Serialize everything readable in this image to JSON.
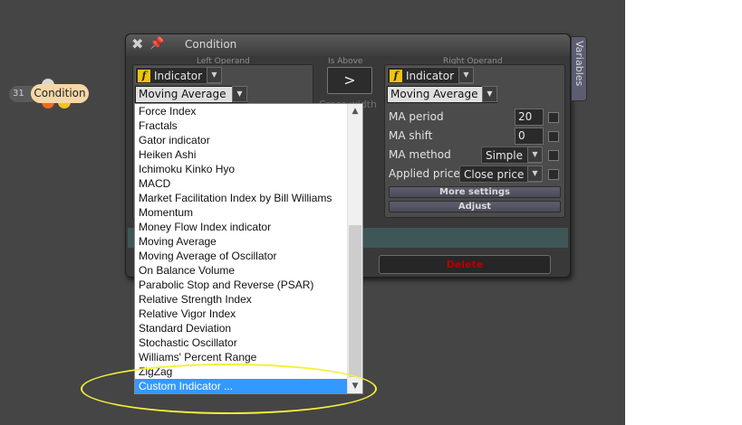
{
  "node": {
    "number": "31",
    "label": "Condition"
  },
  "dialog": {
    "title": "Condition",
    "variables_tab": "Variables",
    "left_operand_header": "Left Operand",
    "operator_header": "Is Above",
    "right_operand_header": "Right Operand",
    "operator_symbol": ">",
    "ghost_text": "Cross width",
    "delete_label": "Delete"
  },
  "left": {
    "type_label": "Indicator",
    "indicator_selected": "Moving Average"
  },
  "right": {
    "type_label": "Indicator",
    "indicator_selected": "Moving Average",
    "ma_period_label": "MA period",
    "ma_period_value": "20",
    "ma_shift_label": "MA shift",
    "ma_shift_value": "0",
    "ma_method_label": "MA method",
    "ma_method_value": "Simple",
    "applied_price_label": "Applied price",
    "applied_price_value": "Close price",
    "more_settings_label": "More settings",
    "adjust_label": "Adjust"
  },
  "dropdown": {
    "items": [
      "Force Index",
      "Fractals",
      "Gator indicator",
      "Heiken Ashi",
      "Ichimoku Kinko Hyo",
      "MACD",
      "Market Facilitation Index by Bill Williams",
      "Momentum",
      "Money Flow Index indicator",
      "Moving Average",
      "Moving Average of Oscillator",
      "On Balance Volume",
      "Parabolic Stop and Reverse (PSAR)",
      "Relative Strength Index",
      "Relative Vigor Index",
      "Standard Deviation",
      "Stochastic Oscillator",
      "Williams' Percent Range",
      "ZigZag",
      "Custom Indicator ..."
    ],
    "selected_index": 19
  },
  "colors": {
    "canvas": "#454545",
    "selection": "#3399ff",
    "highlight": "#f5f03a",
    "delete_text": "#b80000",
    "badge": "#f1c40f"
  },
  "icons": {
    "close": "close-icon",
    "pin": "pin-icon",
    "function": "function-icon",
    "chevron": "chevron-down-icon"
  }
}
